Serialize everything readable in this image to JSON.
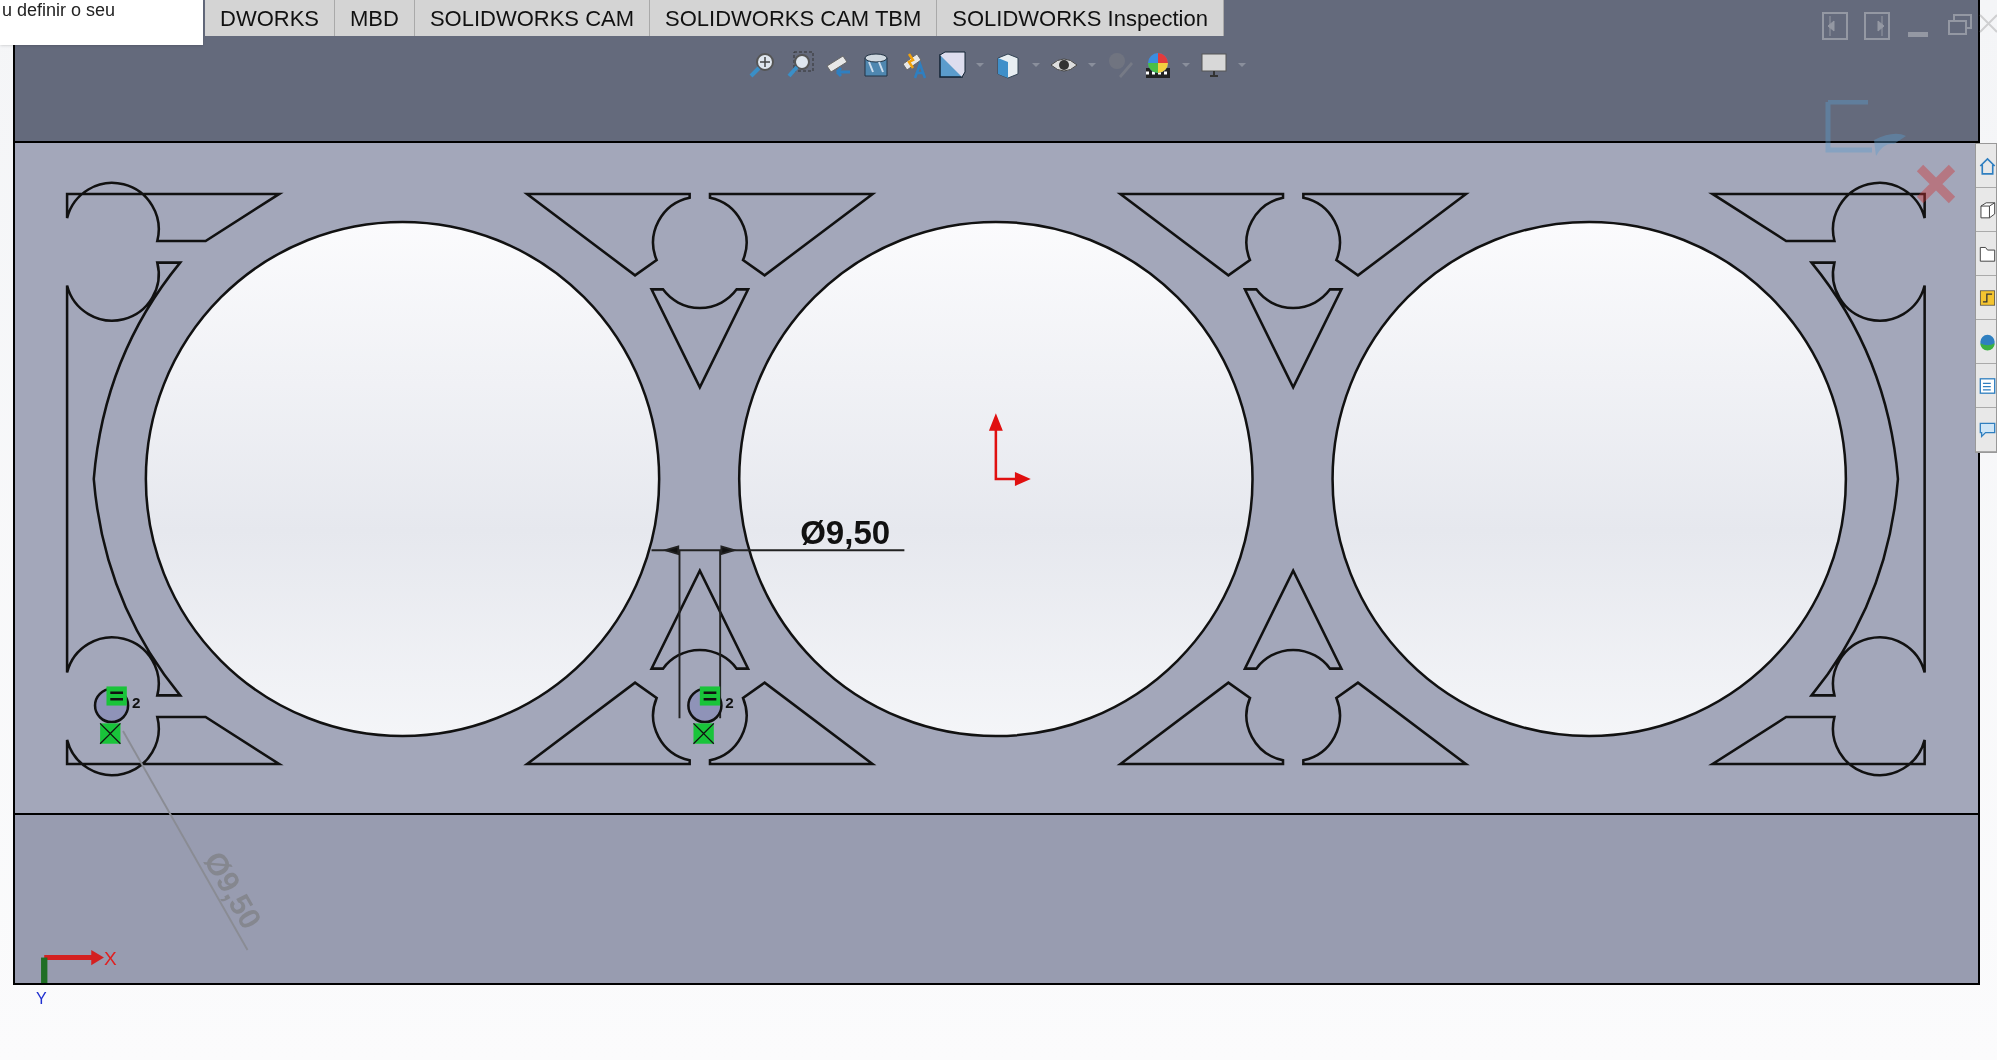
{
  "popup": {
    "text": "u definir o seu"
  },
  "tabs": [
    {
      "label": "DWORKS",
      "selected": false
    },
    {
      "label": "MBD",
      "selected": false
    },
    {
      "label": "SOLIDWORKS CAM",
      "selected": false
    },
    {
      "label": "SOLIDWORKS CAM TBM",
      "selected": false
    },
    {
      "label": "SOLIDWORKS Inspection",
      "selected": false
    }
  ],
  "toolbar": [
    {
      "kind": "zoom-fit",
      "disabled": false,
      "dropdown": false
    },
    {
      "kind": "zoom-area",
      "disabled": false,
      "dropdown": false
    },
    {
      "kind": "previous-view",
      "disabled": false,
      "dropdown": false
    },
    {
      "kind": "section",
      "disabled": false,
      "dropdown": false
    },
    {
      "kind": "annotation",
      "disabled": false,
      "dropdown": false
    },
    {
      "kind": "orientation",
      "disabled": false,
      "dropdown": true
    },
    {
      "kind": "display-style",
      "disabled": false,
      "dropdown": true
    },
    {
      "kind": "hide-show",
      "disabled": false,
      "dropdown": true
    },
    {
      "kind": "appearance",
      "disabled": true,
      "dropdown": false
    },
    {
      "kind": "scene",
      "disabled": false,
      "dropdown": true
    },
    {
      "kind": "view-settings",
      "disabled": false,
      "dropdown": true
    }
  ],
  "drawing": {
    "dimension": "Ø9,50",
    "faded_dimension": "Ø9,50",
    "relation_labels": [
      "2",
      "2"
    ],
    "axis_x": "X",
    "axis_y": "Y"
  }
}
